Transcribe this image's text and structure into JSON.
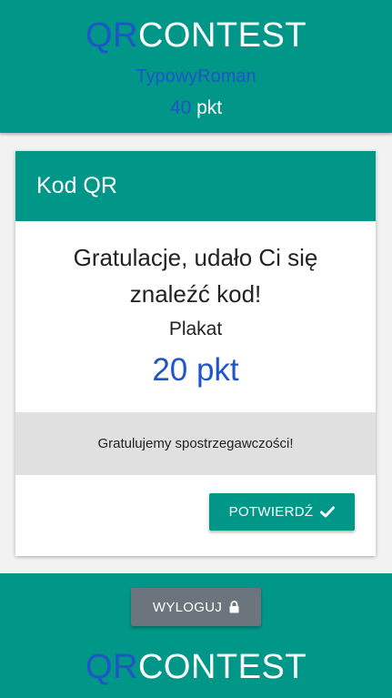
{
  "colors": {
    "primary": "#009688",
    "accent_blue": "#1e55c8",
    "button_gray": "#6c757d",
    "band_gray": "#e0e0e0"
  },
  "header": {
    "logo_qr": "QR",
    "logo_contest": "CONTEST",
    "username": "TypowyRoman",
    "points_value": "40",
    "points_unit": "pkt"
  },
  "card": {
    "title": "Kod QR",
    "congrats": "Gratulacje, udało Ci się znaleźć kod!",
    "qr_name": "Plakat",
    "qr_points": "20 pkt",
    "message": "Gratulujemy spostrzegawczości!",
    "confirm_label": "POTWIERDŹ",
    "confirm_icon": "check-icon"
  },
  "footer": {
    "logout_label": "WYLOGUJ",
    "logout_icon": "lock-icon",
    "logo_qr": "QR",
    "logo_contest": "CONTEST"
  }
}
